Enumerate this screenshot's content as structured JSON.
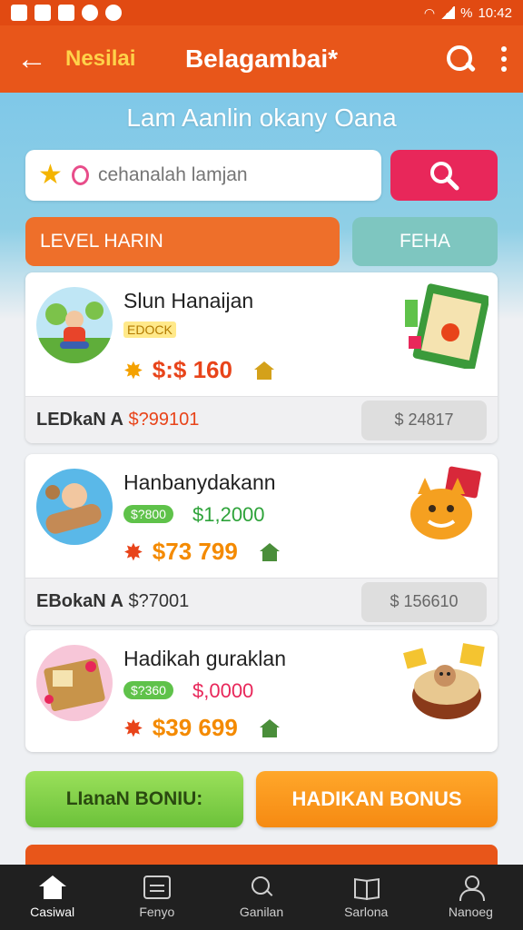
{
  "status_bar": {
    "time": "10:42",
    "battery": "%"
  },
  "app_bar": {
    "back_label": "←",
    "subtitle": "Nesilai",
    "title": "Belagambai*"
  },
  "headline": "Lam Aanlin okany Oana",
  "search": {
    "placeholder": "cehanalah lamjan"
  },
  "tabs": {
    "level": "LEVEL HARIN",
    "feha": "FEHA"
  },
  "cards": [
    {
      "title": "Slun Hanaijan",
      "tag": "EDOCK",
      "price": "$:$ 160",
      "sub_label_prefix": "LEDkaN A",
      "sub_label_value": "$?99101",
      "sub_right": "$ 24817"
    },
    {
      "title": "Hanbanydakann",
      "pill": "$?800",
      "pill_price": "$1,2000",
      "price": "$73 799",
      "sub_label_prefix": "EBokaN A",
      "sub_label_value": "$?7001",
      "sub_right": "$ 156610"
    },
    {
      "title": "Hadikah guraklan",
      "pill": "$?360",
      "pill_price": "$,0000",
      "price": "$39 699"
    }
  ],
  "bonus": {
    "green": "LIanaN BONIU:",
    "orange": "HADIKAN BONUS"
  },
  "nav": [
    {
      "label": "Casiwal",
      "icon": "home-icon"
    },
    {
      "label": "Fenyo",
      "icon": "gift-box-icon"
    },
    {
      "label": "Ganilan",
      "icon": "search-icon"
    },
    {
      "label": "Sarlona",
      "icon": "book-icon"
    },
    {
      "label": "Nanoeg",
      "icon": "user-icon"
    }
  ],
  "colors": {
    "app_bar": "#e8561a",
    "accent_pink": "#e8275a",
    "accent_orange": "#ee6f2a",
    "accent_green": "#6cc23a",
    "nav_bg": "#202020"
  }
}
